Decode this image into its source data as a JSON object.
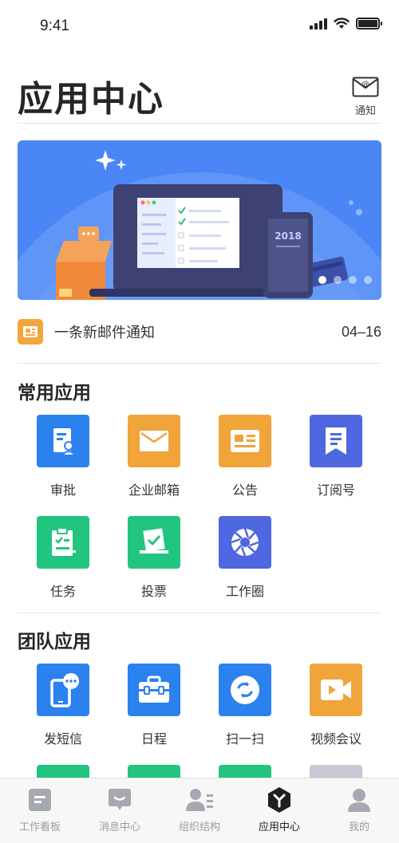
{
  "status_bar": {
    "time": "9:41"
  },
  "header": {
    "title": "应用中心",
    "notify_label": "通知"
  },
  "banner": {
    "device_year": "2018",
    "slides": 4,
    "active_slide": 1
  },
  "notice": {
    "text": "一条新邮件通知",
    "date": "04–16",
    "icon": "newspaper-icon"
  },
  "sections": [
    {
      "title": "常用应用",
      "apps": [
        {
          "label": "审批",
          "icon": "approval-icon",
          "color": "#2b82ef"
        },
        {
          "label": "企业邮箱",
          "icon": "mail-icon",
          "color": "#f0a43a"
        },
        {
          "label": "公告",
          "icon": "announcement-icon",
          "color": "#f0a43a"
        },
        {
          "label": "订阅号",
          "icon": "bookmark-icon",
          "color": "#4f67e0"
        },
        {
          "label": "任务",
          "icon": "clipboard-icon",
          "color": "#22c57f"
        },
        {
          "label": "投票",
          "icon": "ballot-icon",
          "color": "#22c57f"
        },
        {
          "label": "工作圈",
          "icon": "aperture-icon",
          "color": "#4f67e0"
        }
      ]
    },
    {
      "title": "团队应用",
      "apps": [
        {
          "label": "发短信",
          "icon": "phone-message-icon",
          "color": "#2b82ef"
        },
        {
          "label": "日程",
          "icon": "briefcase-icon",
          "color": "#2b82ef"
        },
        {
          "label": "扫一扫",
          "icon": "scan-icon",
          "color": "#2b82ef"
        },
        {
          "label": "视频会议",
          "icon": "video-icon",
          "color": "#f0a43a"
        }
      ]
    }
  ],
  "tabbar": [
    {
      "label": "工作看板",
      "icon": "board-icon",
      "active": false
    },
    {
      "label": "消息中心",
      "icon": "message-icon",
      "active": false
    },
    {
      "label": "组织结构",
      "icon": "org-icon",
      "active": false
    },
    {
      "label": "应用中心",
      "icon": "app-center-icon",
      "active": true
    },
    {
      "label": "我的",
      "icon": "profile-icon",
      "active": false
    }
  ]
}
